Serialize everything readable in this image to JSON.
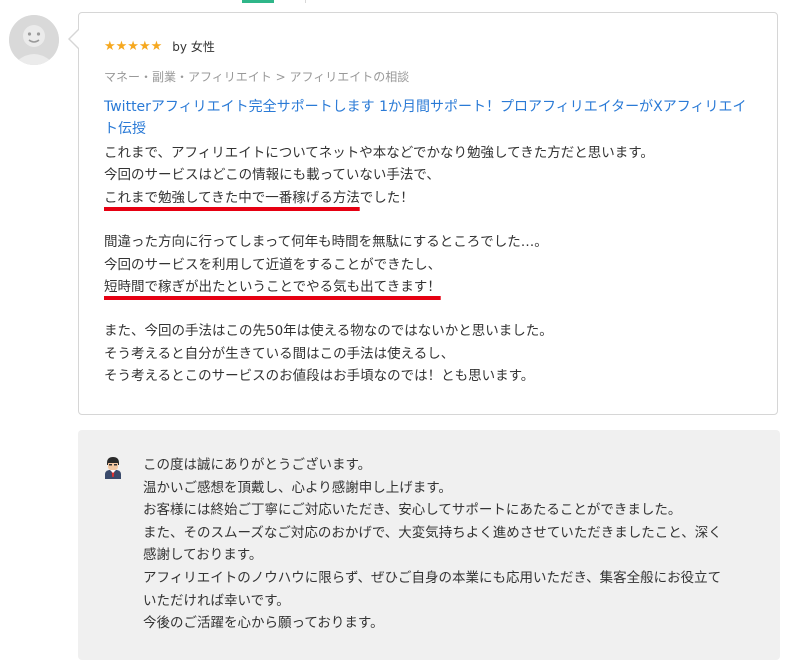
{
  "review": {
    "stars": "★★★★★",
    "rating": 5,
    "by_label": "by 女性",
    "category": "マネー・副業・アフィリエイト > アフィリエイトの相談",
    "service_title": "Twitterアフィリエイト完全サポートします 1か月間サポート！プロアフィリエイターがXアフィリエイト伝授",
    "paragraphs": [
      {
        "lines": [
          "これまで、アフィリエイトについてネットや本などでかなり勉強してきた方だと思います。",
          "今回のサービスはどこの情報にも載っていない手法で、"
        ],
        "highlight_line": {
          "underlined": "これまで勉強してきた中で一番稼げる方法",
          "rest": "でした！"
        }
      },
      {
        "lines": [
          "間違った方向に行ってしまって何年も時間を無駄にするところでした…。",
          "今回のサービスを利用して近道をすることができたし、"
        ],
        "highlight_line": {
          "underlined": "短時間で稼ぎが出たということでやる気も出てきます！",
          "rest": ""
        }
      },
      {
        "lines": [
          "また、今回の手法はこの先50年は使える物なのではないかと思いました。",
          "そう考えると自分が生きている間はこの手法は使えるし、",
          "そう考えるとこのサービスのお値段はお手頃なのでは！とも思います。"
        ]
      }
    ]
  },
  "reply": {
    "lines": [
      "この度は誠にありがとうございます。",
      "温かいご感想を頂戴し、心より感謝申し上げます。",
      "お客様には終始ご丁寧にご対応いただき、安心してサポートにあたることができました。",
      "また、そのスムーズなご対応のおかげで、大変気持ちよく進めさせていただきましたこと、深く",
      "感謝しております。",
      "アフィリエイトのノウハウに限らず、ぜひご自身の本業にも応用いただき、集客全般にお役立て",
      "いただければ幸いです。",
      "今後のご活躍を心から願っております。"
    ]
  },
  "colors": {
    "star": "#f6a81f",
    "link": "#2a7ad6",
    "underline": "#e60012",
    "reply_bg": "#f0f0f0",
    "tab_accent": "#2fb689"
  },
  "icons": {
    "avatar": "default-user-avatar-icon",
    "seller": "businessman-avatar-icon"
  }
}
